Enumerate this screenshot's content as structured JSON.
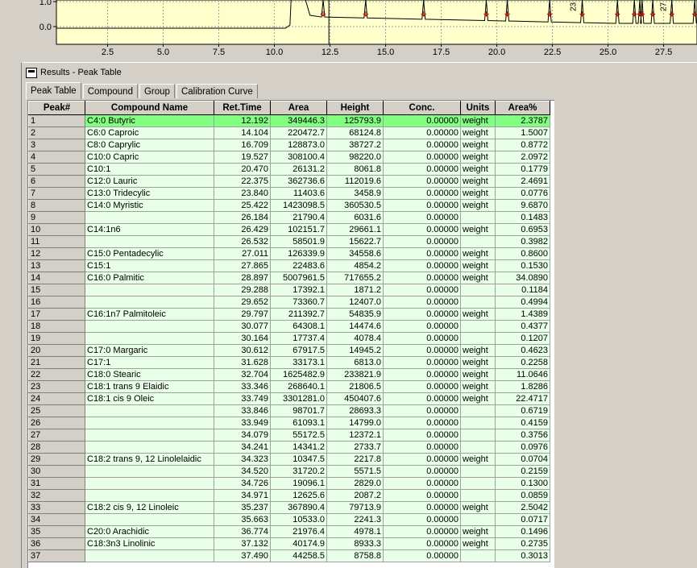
{
  "chart": {
    "y_ticks": [
      "1.0",
      "0.0"
    ],
    "x_ticks": [
      "2.5",
      "5.0",
      "7.5",
      "10.0",
      "12.5",
      "15.0",
      "17.5",
      "20.0",
      "22.5",
      "25.0",
      "27.5"
    ],
    "peak_labels": [
      "23",
      "27"
    ],
    "colors": {
      "background": "#ffffcc",
      "trace": "#000000",
      "markers": "#cc0000"
    }
  },
  "results": {
    "title": "Results - Peak Table",
    "tabs": [
      "Peak Table",
      "Compound",
      "Group",
      "Calibration Curve"
    ],
    "columns": [
      "Peak#",
      "Compound Name",
      "Ret.Time",
      "Area",
      "Height",
      "Conc.",
      "Units",
      "Area%"
    ],
    "rows": [
      [
        "1",
        "C4:0 Butyric",
        "12.192",
        "349446.3",
        "125793.9",
        "0.00000",
        "weight",
        "2.3787"
      ],
      [
        "2",
        "C6:0 Caproic",
        "14.104",
        "220472.7",
        "68124.8",
        "0.00000",
        "weight",
        "1.5007"
      ],
      [
        "3",
        "C8:0 Caprylic",
        "16.709",
        "128873.0",
        "38727.2",
        "0.00000",
        "weight",
        "0.8772"
      ],
      [
        "4",
        "C10:0 Capric",
        "19.527",
        "308100.4",
        "98220.0",
        "0.00000",
        "weight",
        "2.0972"
      ],
      [
        "5",
        "C10:1",
        "20.470",
        "26131.2",
        "8061.8",
        "0.00000",
        "weight",
        "0.1779"
      ],
      [
        "6",
        "C12:0 Lauric",
        "22.375",
        "362736.6",
        "112019.6",
        "0.00000",
        "weight",
        "2.4691"
      ],
      [
        "7",
        "C13:0 Tridecylic",
        "23.840",
        "11403.6",
        "3458.9",
        "0.00000",
        "weight",
        "0.0776"
      ],
      [
        "8",
        "C14:0 Myristic",
        "25.422",
        "1423098.5",
        "360530.5",
        "0.00000",
        "weight",
        "9.6870"
      ],
      [
        "9",
        "",
        "26.184",
        "21790.4",
        "6031.6",
        "0.00000",
        "",
        "0.1483"
      ],
      [
        "10",
        "C14:1n6",
        "26.429",
        "102151.7",
        "29661.1",
        "0.00000",
        "weight",
        "0.6953"
      ],
      [
        "11",
        "",
        "26.532",
        "58501.9",
        "15622.7",
        "0.00000",
        "",
        "0.3982"
      ],
      [
        "12",
        "C15:0 Pentadecylic",
        "27.011",
        "126339.9",
        "34558.6",
        "0.00000",
        "weight",
        "0.8600"
      ],
      [
        "13",
        "C15:1",
        "27.865",
        "22483.6",
        "4854.2",
        "0.00000",
        "weight",
        "0.1530"
      ],
      [
        "14",
        "C16:0 Palmitic",
        "28.897",
        "5007961.5",
        "717655.2",
        "0.00000",
        "weight",
        "34.0890"
      ],
      [
        "15",
        "",
        "29.288",
        "17392.1",
        "1871.2",
        "0.00000",
        "",
        "0.1184"
      ],
      [
        "16",
        "",
        "29.652",
        "73360.7",
        "12407.0",
        "0.00000",
        "",
        "0.4994"
      ],
      [
        "17",
        "C16:1n7 Palmitoleic",
        "29.797",
        "211392.7",
        "54835.9",
        "0.00000",
        "weight",
        "1.4389"
      ],
      [
        "18",
        "",
        "30.077",
        "64308.1",
        "14474.6",
        "0.00000",
        "",
        "0.4377"
      ],
      [
        "19",
        "",
        "30.164",
        "17737.4",
        "4078.4",
        "0.00000",
        "",
        "0.1207"
      ],
      [
        "20",
        "C17:0 Margaric",
        "30.612",
        "67917.5",
        "14945.2",
        "0.00000",
        "weight",
        "0.4623"
      ],
      [
        "21",
        "C17:1",
        "31.628",
        "33173.1",
        "6813.0",
        "0.00000",
        "weight",
        "0.2258"
      ],
      [
        "22",
        "C18:0 Stearic",
        "32.704",
        "1625482.9",
        "233821.9",
        "0.00000",
        "weight",
        "11.0646"
      ],
      [
        "23",
        "C18:1 trans 9 Elaidic",
        "33.346",
        "268640.1",
        "21806.5",
        "0.00000",
        "weight",
        "1.8286"
      ],
      [
        "24",
        "C18:1 cis 9 Oleic",
        "33.749",
        "3301281.0",
        "450407.6",
        "0.00000",
        "weight",
        "22.4717"
      ],
      [
        "25",
        "",
        "33.846",
        "98701.7",
        "28693.3",
        "0.00000",
        "",
        "0.6719"
      ],
      [
        "26",
        "",
        "33.949",
        "61093.1",
        "14799.0",
        "0.00000",
        "",
        "0.4159"
      ],
      [
        "27",
        "",
        "34.079",
        "55172.5",
        "12372.1",
        "0.00000",
        "",
        "0.3756"
      ],
      [
        "28",
        "",
        "34.241",
        "14341.2",
        "2733.7",
        "0.00000",
        "",
        "0.0976"
      ],
      [
        "29",
        "C18:2 trans 9, 12 Linolelaidic",
        "34.323",
        "10347.5",
        "2217.8",
        "0.00000",
        "weight",
        "0.0704"
      ],
      [
        "30",
        "",
        "34.520",
        "31720.2",
        "5571.5",
        "0.00000",
        "",
        "0.2159"
      ],
      [
        "31",
        "",
        "34.726",
        "19096.1",
        "2829.0",
        "0.00000",
        "",
        "0.1300"
      ],
      [
        "32",
        "",
        "34.971",
        "12625.6",
        "2087.2",
        "0.00000",
        "",
        "0.0859"
      ],
      [
        "33",
        "C18:2 cis 9, 12  Linoleic",
        "35.237",
        "367890.4",
        "79713.9",
        "0.00000",
        "weight",
        "2.5042"
      ],
      [
        "34",
        "",
        "35.663",
        "10533.0",
        "2241.3",
        "0.00000",
        "",
        "0.0717"
      ],
      [
        "35",
        "C20:0 Arachidic",
        "36.774",
        "21976.4",
        "4978.1",
        "0.00000",
        "weight",
        "0.1496"
      ],
      [
        "36",
        "C18:3n3 Linolinic",
        "37.132",
        "40174.9",
        "8933.3",
        "0.00000",
        "weight",
        "0.2735"
      ],
      [
        "37",
        "",
        "37.490",
        "44258.5",
        "8758.8",
        "0.00000",
        "",
        "0.3013"
      ]
    ]
  }
}
